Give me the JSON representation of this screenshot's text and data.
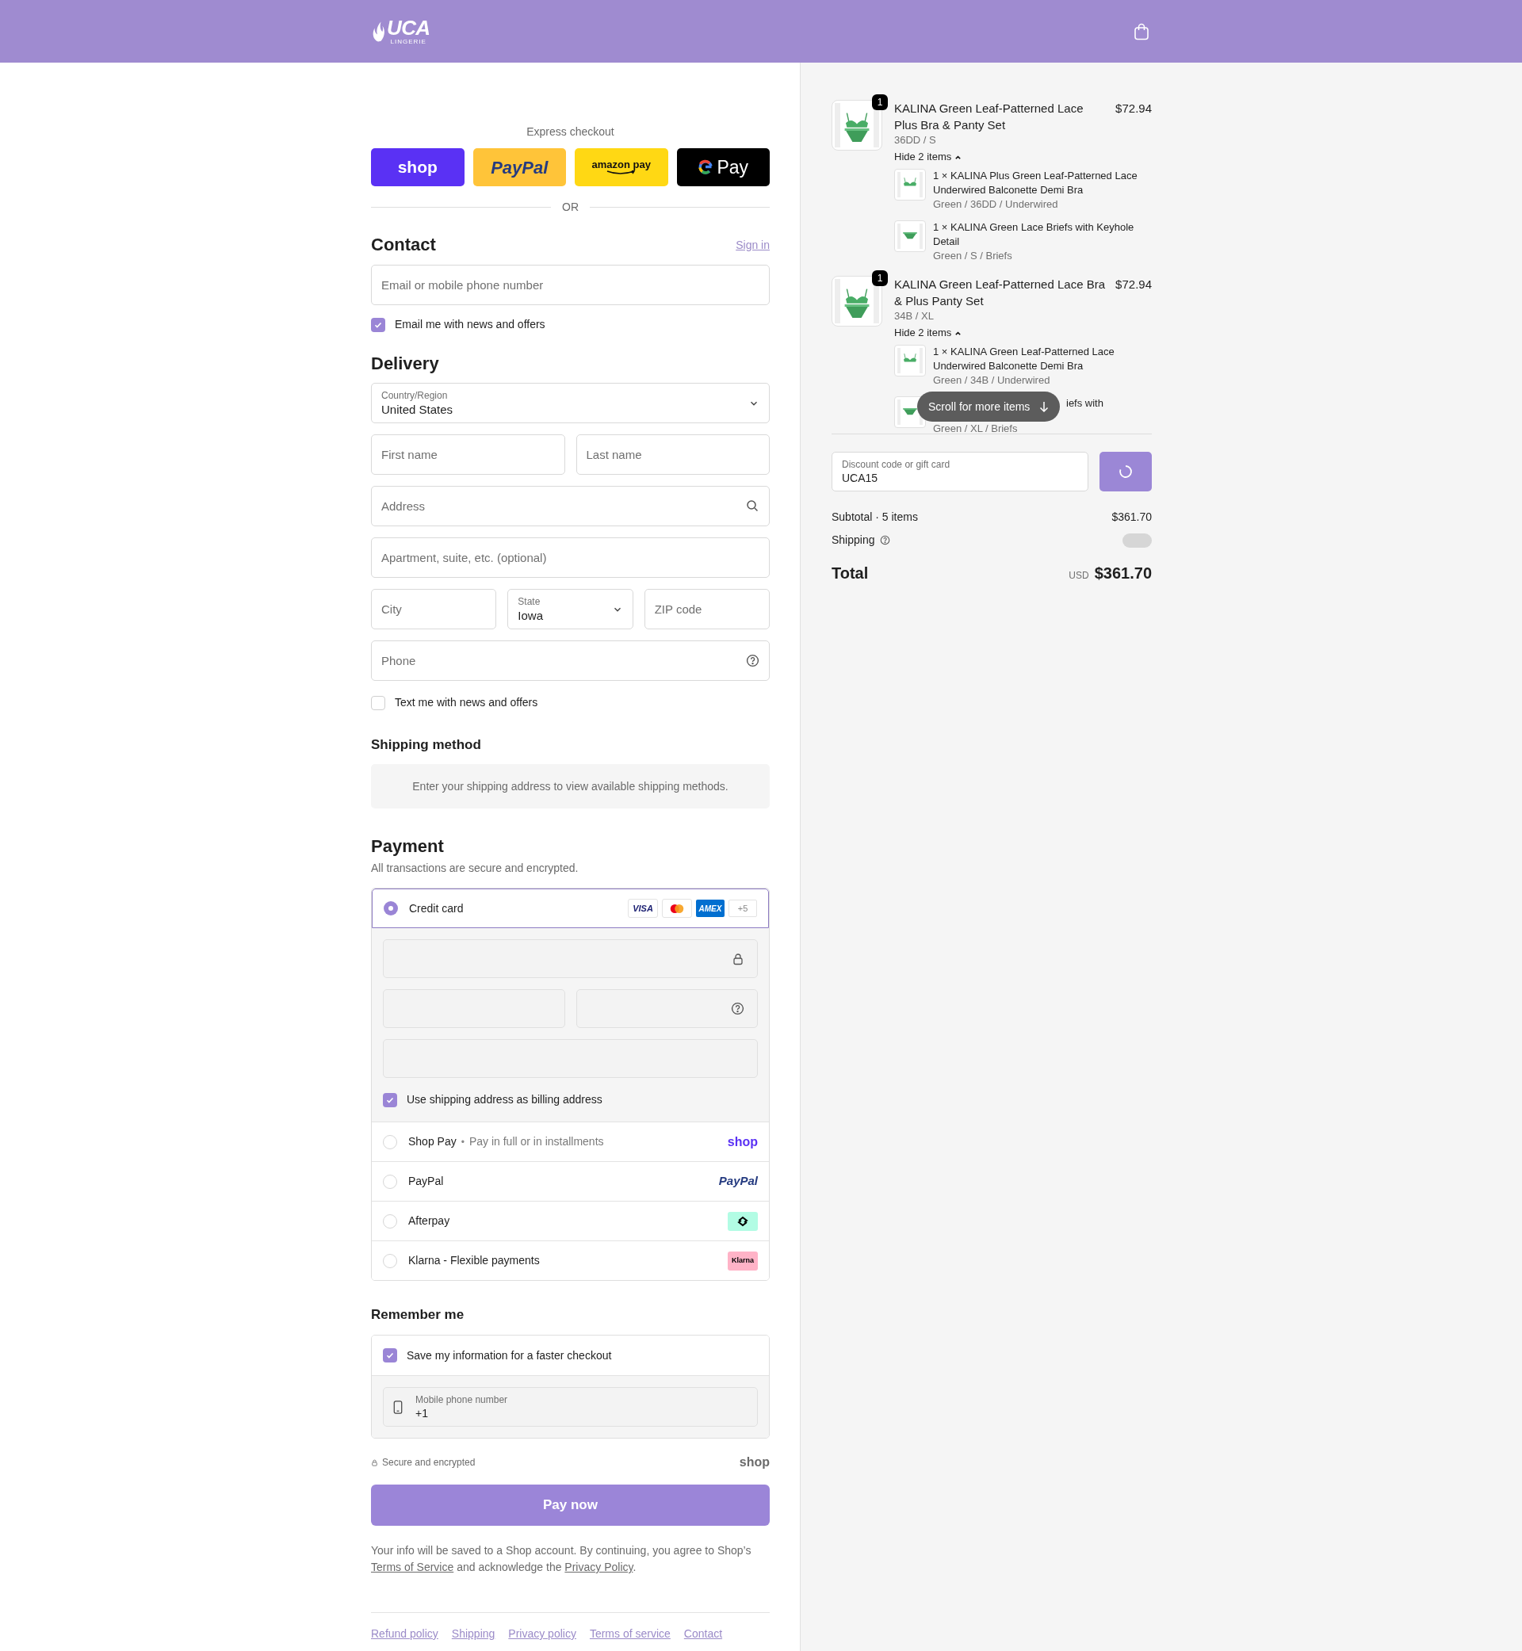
{
  "header": {
    "logo": "UCA",
    "logo_sub": "LINGERIE"
  },
  "express_checkout": {
    "title": "Express checkout",
    "buttons": [
      {
        "kind": "shop",
        "label": "shop"
      },
      {
        "kind": "paypal",
        "label": "PayPal"
      },
      {
        "kind": "amazon",
        "label": "amazon pay"
      },
      {
        "kind": "gpay",
        "label": "Pay"
      }
    ],
    "divider": "OR"
  },
  "contact": {
    "title": "Contact",
    "sign_in": "Sign in",
    "email": {
      "placeholder": "Email or mobile phone number"
    },
    "newsletter": {
      "label": "Email me with news and offers",
      "checked": true
    }
  },
  "delivery": {
    "title": "Delivery",
    "rows": [
      [
        {
          "kind": "select",
          "label": "Country/Region",
          "value": "United States"
        }
      ],
      [
        {
          "kind": "text",
          "placeholder": "First name"
        },
        {
          "kind": "text",
          "placeholder": "Last name"
        }
      ],
      [
        {
          "kind": "search",
          "placeholder": "Address"
        }
      ],
      [
        {
          "kind": "text",
          "placeholder": "Apartment, suite, etc. (optional)"
        }
      ],
      [
        {
          "kind": "text",
          "placeholder": "City"
        },
        {
          "kind": "select",
          "label": "State",
          "value": "Iowa"
        },
        {
          "kind": "text",
          "placeholder": "ZIP code"
        }
      ],
      [
        {
          "kind": "phone",
          "placeholder": "Phone"
        }
      ]
    ],
    "sms": {
      "label": "Text me with news and offers",
      "checked": false
    }
  },
  "shipping_method": {
    "title": "Shipping method",
    "notice": "Enter your shipping address to view available shipping methods."
  },
  "payment": {
    "title": "Payment",
    "subtitle": "All transactions are secure and encrypted.",
    "methods": [
      {
        "kind": "card",
        "label": "Credit card",
        "selected": true,
        "brands": [
          {
            "kind": "visa",
            "label": "VISA"
          },
          {
            "kind": "mastercard"
          },
          {
            "kind": "amex",
            "label": "AMEX"
          }
        ],
        "more": "+5",
        "billing": {
          "label": "Use shipping address as billing address",
          "checked": true
        }
      },
      {
        "kind": "shop_pay",
        "label": "Shop Pay",
        "separator": "•",
        "note": "Pay in full or in installments",
        "badge": "shop",
        "selected": false
      },
      {
        "kind": "paypal",
        "label": "PayPal",
        "badge": "PayPal",
        "selected": false
      },
      {
        "kind": "afterpay",
        "label": "Afterpay",
        "selected": false
      },
      {
        "kind": "klarna",
        "label": "Klarna - Flexible payments",
        "badge": "Klarna",
        "selected": false
      }
    ]
  },
  "remember_me": {
    "title": "Remember me",
    "save": {
      "label": "Save my information for a faster checkout",
      "checked": true
    },
    "phone": {
      "label": "Mobile phone number",
      "value": "+1"
    }
  },
  "secure_note": "Secure and encrypted",
  "shop_mark": "shop",
  "pay_button": "Pay now",
  "legal": {
    "before": "Your info will be saved to a Shop account. By continuing, you agree to Shop’s",
    "link_1": "Terms of Service",
    "middle": "and acknowledge the",
    "link_2": "Privacy Policy",
    "after": "."
  },
  "footer_links": [
    "Refund policy",
    "Shipping",
    "Privacy policy",
    "Terms of service",
    "Contact"
  ],
  "summary": {
    "items": [
      {
        "quantity": "1",
        "name": "KALINA Green Leaf-Patterned Lace Plus Bra & Panty Set",
        "price": "$72.94",
        "variant": "36DD / S",
        "toggle": "Hide 2 items",
        "expanded": true,
        "components": [
          {
            "kind": "full",
            "name": "1 × KALINA Plus Green Leaf-Patterned Lace Underwired Balconette Demi Bra",
            "variant": "Green / 36DD / Underwired"
          },
          {
            "kind": "full",
            "name": "1 × KALINA Green Lace Briefs with Keyhole Detail",
            "variant": "Green / S / Briefs"
          }
        ]
      },
      {
        "quantity": "1",
        "name": "KALINA Green Leaf-Patterned Lace Bra & Plus Panty Set",
        "price": "$72.94",
        "variant": "34B / XL",
        "toggle": "Hide 2 items",
        "expanded": true,
        "components": [
          {
            "kind": "full",
            "name": "1 × KALINA Green Leaf-Patterned Lace Underwired Balconette Demi Bra",
            "variant": "Green / 34B / Underwired"
          },
          {
            "kind": "partial",
            "name": "iefs with",
            "variant": "Green / XL / Briefs"
          }
        ]
      }
    ],
    "scroll_hint": "Scroll for more items",
    "discount": {
      "label": "Discount code or gift card",
      "value": "UCA15"
    },
    "subtotal_label": "Subtotal · 5 items",
    "subtotal": "$361.70",
    "shipping_label": "Shipping",
    "total_label": "Total",
    "currency": "USD",
    "total": "$361.70"
  }
}
